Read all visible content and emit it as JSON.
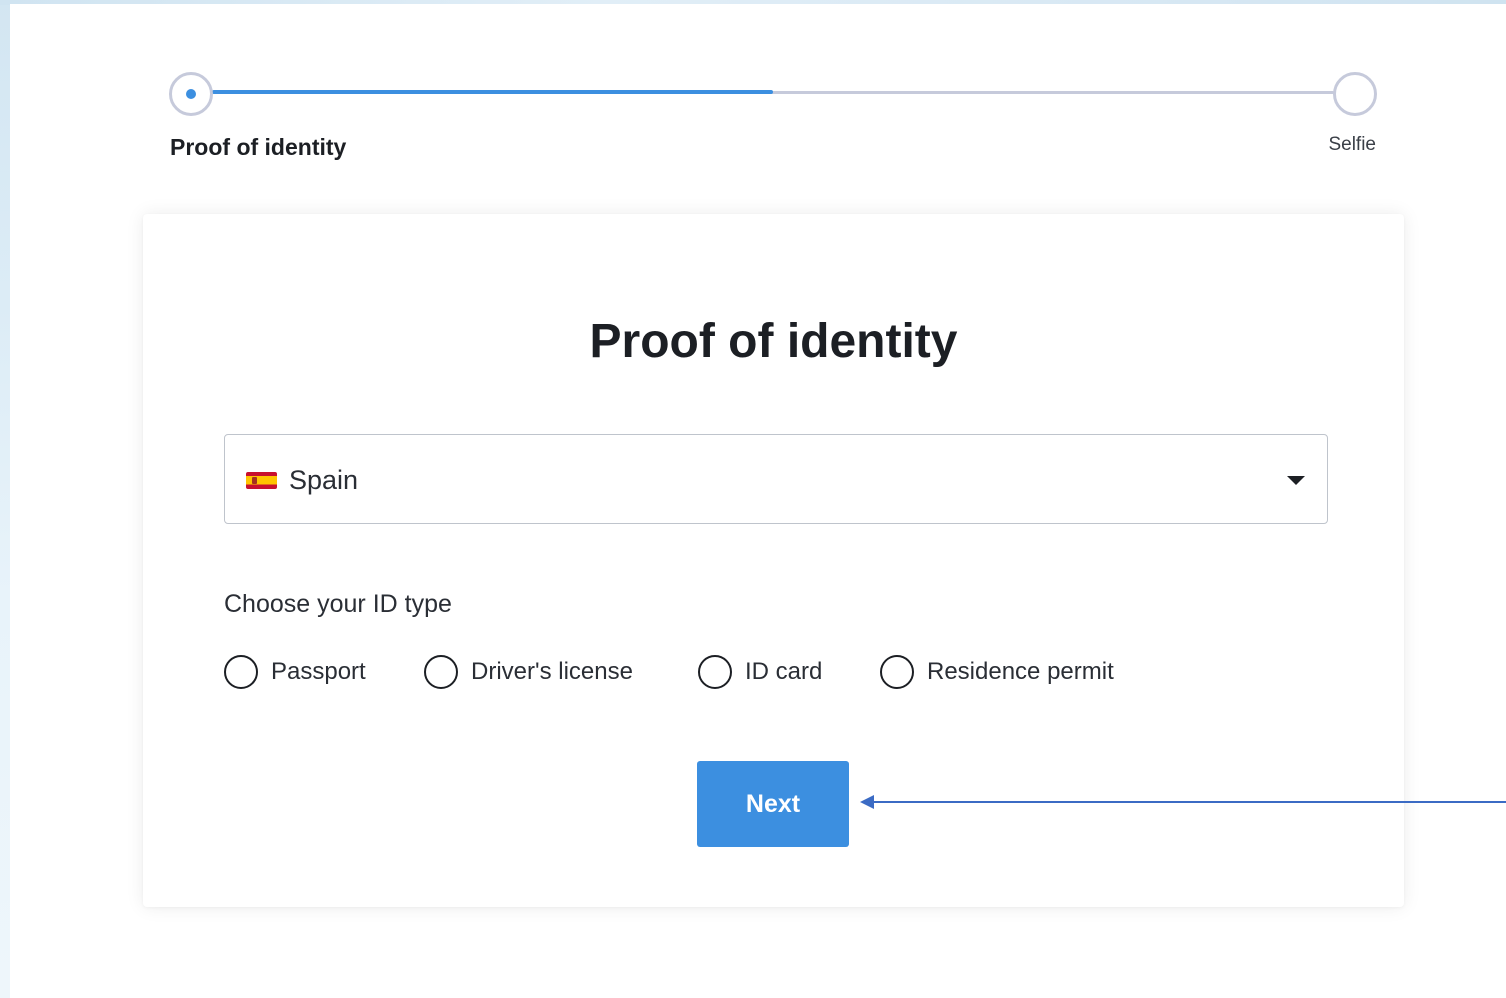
{
  "stepper": {
    "steps": [
      {
        "label": "Proof of identity",
        "state": "active"
      },
      {
        "label": "Selfie",
        "state": "pending"
      }
    ],
    "progress_percent": 50,
    "accent_color": "#3c8fe0"
  },
  "card": {
    "title": "Proof of identity",
    "country_select": {
      "flag_icon": "spain-flag-icon",
      "value": "Spain",
      "dropdown_icon": "chevron-down-icon"
    },
    "id_type_label": "Choose your ID type",
    "id_types": [
      {
        "label": "Passport",
        "selected": false
      },
      {
        "label": "Driver's license",
        "selected": false
      },
      {
        "label": "ID card",
        "selected": false
      },
      {
        "label": "Residence permit",
        "selected": false
      }
    ],
    "next_button": "Next"
  },
  "annotation": {
    "arrow_icon": "arrow-left-icon",
    "color": "#3b6bc4"
  }
}
